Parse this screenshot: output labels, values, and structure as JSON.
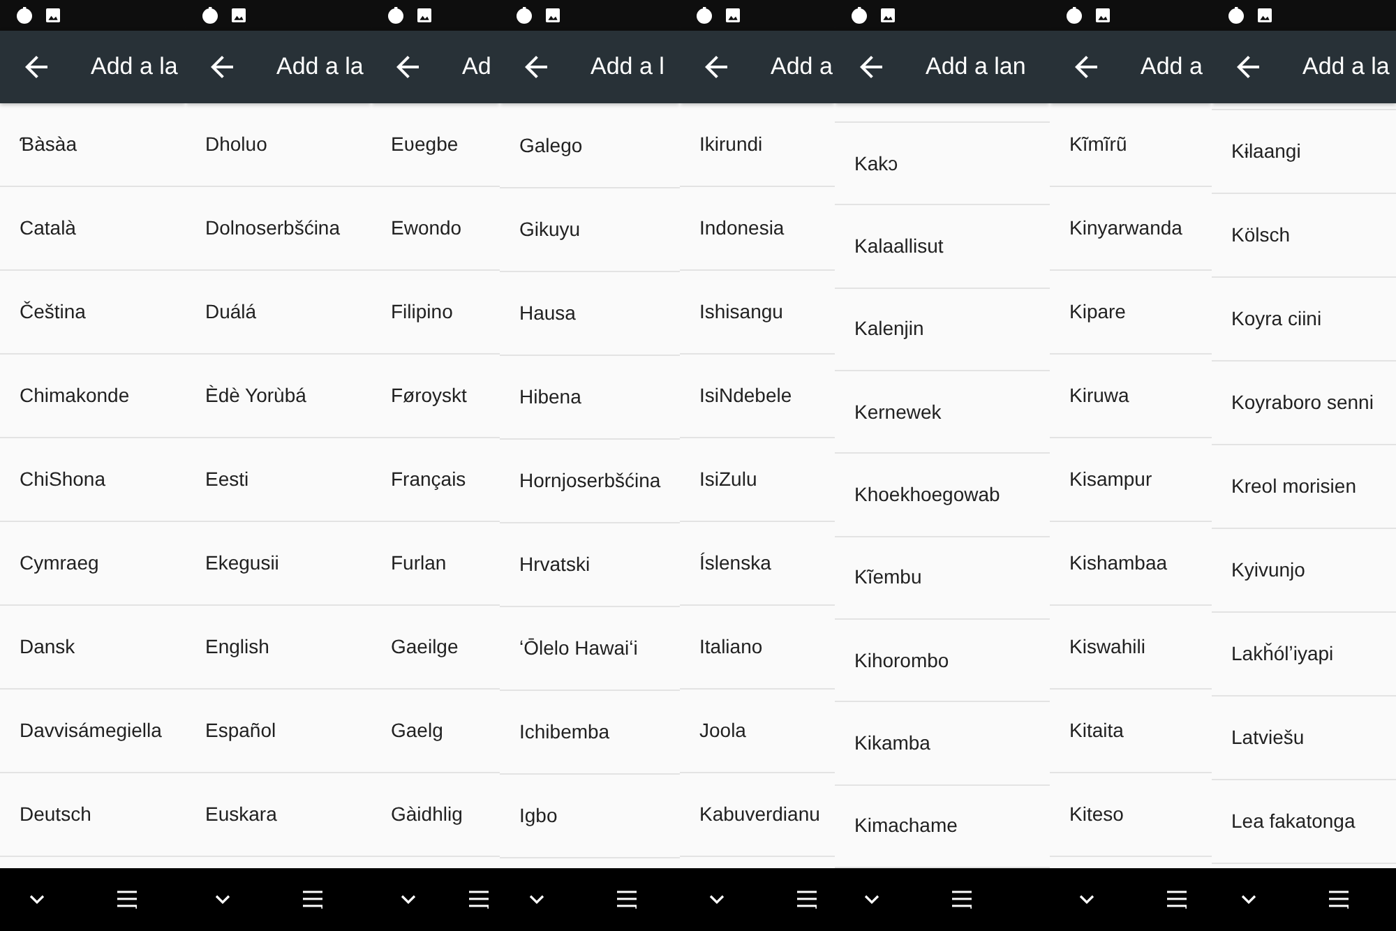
{
  "panels": [
    {
      "title": "Add a la",
      "languages": [
        "Ɓàsàa",
        "Català",
        "Čeština",
        "Chimakonde",
        "ChiShona",
        "Cymraeg",
        "Dansk",
        "Davvisámegiella",
        "Deutsch"
      ]
    },
    {
      "title": "Add a la",
      "languages": [
        "Dholuo",
        "Dolnoserbšćina",
        "Duálá",
        "Èdè Yorùbá",
        "Eesti",
        "Ekegusii",
        "English",
        "Español",
        "Euskara"
      ]
    },
    {
      "title": "Ad",
      "languages": [
        "Eʋegbe",
        "Ewondo",
        "Filipino",
        "Føroyskt",
        "Français",
        "Furlan",
        "Gaeilge",
        "Gaelg",
        "Gàidhlig"
      ]
    },
    {
      "title": "Add a l",
      "languages": [
        "Galego",
        "Gikuyu",
        "Hausa",
        "Hibena",
        "Hornjoserbšćina",
        "Hrvatski",
        "ʻŌlelo Hawaiʻi",
        "Ichibemba",
        "Igbo"
      ]
    },
    {
      "title": "Add a",
      "languages": [
        "Ikirundi",
        "Indonesia",
        "Ishisangu",
        "IsiNdebele",
        "IsiZulu",
        "Íslenska",
        "Italiano",
        "Joola",
        "Kabuverdianu"
      ]
    },
    {
      "title": "Add a lan",
      "languages": [
        "Kakɔ",
        "Kalaallisut",
        "Kalenjin",
        "Kernewek",
        "Khoekhoegowab",
        "Kĩembu",
        "Kihorombo",
        "Kikamba",
        "Kimachame"
      ]
    },
    {
      "title": "Add a",
      "languages": [
        "Kĩmĩrũ",
        "Kinyarwanda",
        "Kipare",
        "Kiruwa",
        "Kisampur",
        "Kishambaa",
        "Kiswahili",
        "Kitaita",
        "Kiteso"
      ]
    },
    {
      "title": "Add a la",
      "languages": [
        "Kɨlaangi",
        "Kölsch",
        "Koyra ciini",
        "Koyraboro senni",
        "Kreol morisien",
        "Kyivunjo",
        "Lakȟólʼiyapi",
        "Latviešu",
        "Lea fakatonga"
      ]
    }
  ]
}
